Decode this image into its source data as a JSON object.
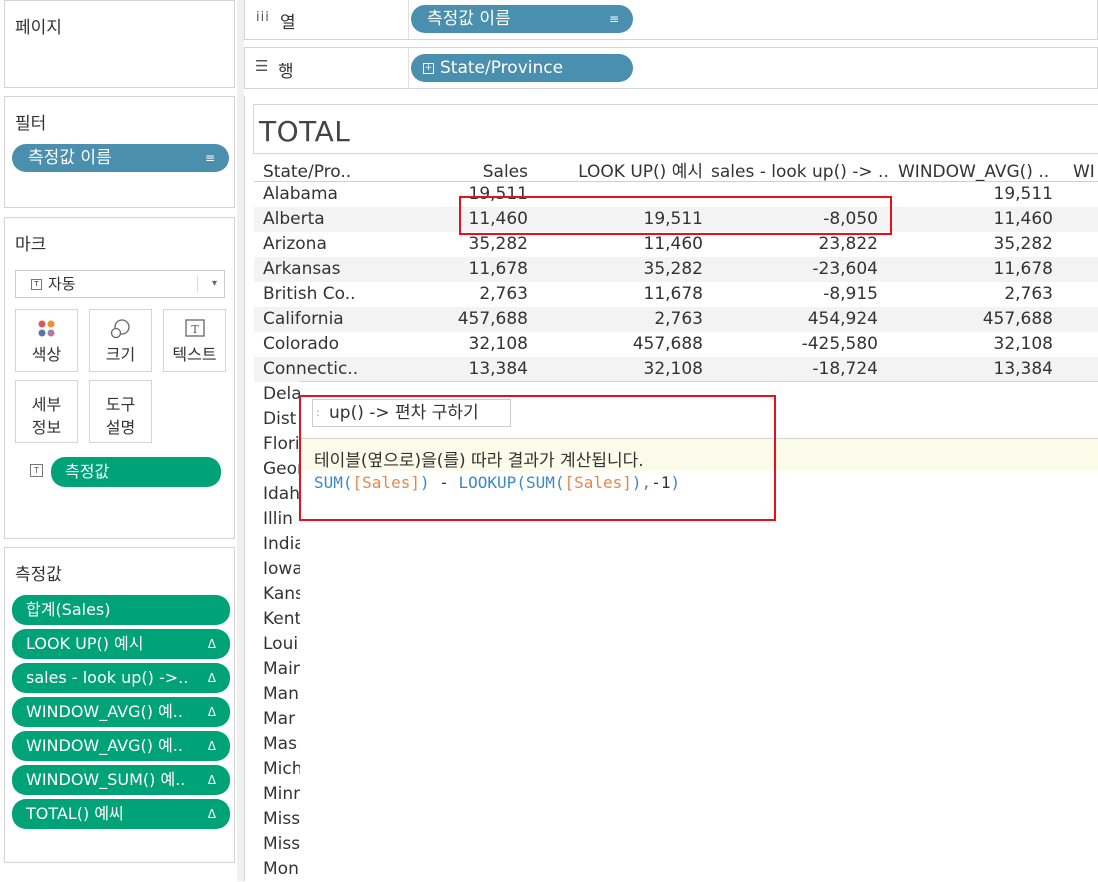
{
  "pages_panel": {
    "title": "페이지"
  },
  "filters_panel": {
    "title": "필터",
    "pill": "측정값 이름"
  },
  "marks_panel": {
    "title": "마크",
    "dropdown": "자동",
    "buttons": [
      {
        "label": "색상",
        "icon": "color-dots-icon"
      },
      {
        "label": "크기",
        "icon": "size-circles-icon"
      },
      {
        "label": "텍스트",
        "icon": "text-box-icon"
      }
    ],
    "buttons2": [
      {
        "label1": "세부",
        "label2": "정보"
      },
      {
        "label1": "도구",
        "label2": "설명"
      }
    ],
    "text_pill": "측정값"
  },
  "measures_panel": {
    "title": "측정값",
    "pills": [
      "합계(Sales)",
      "LOOK UP() 예시",
      "sales - look up() ->..",
      "WINDOW_AVG() 예..",
      "WINDOW_AVG() 예..",
      "WINDOW_SUM() 예..",
      "TOTAL() 예씨"
    ]
  },
  "shelves": {
    "columns_label": "열",
    "columns_pill": "측정값 이름",
    "rows_label": "행",
    "rows_pill": "State/Province"
  },
  "view": {
    "title": "TOTAL",
    "headers": [
      "State/Pro..",
      "Sales",
      "LOOK UP() 예시",
      "sales - look up() -> ..",
      "WINDOW_AVG() ..",
      "WI"
    ],
    "rows": [
      {
        "state": "Alabama",
        "sales": "19,511",
        "lookup": "",
        "diff": "",
        "wavg": "19,511"
      },
      {
        "state": "Alberta",
        "sales": "11,460",
        "lookup": "19,511",
        "diff": "-8,050",
        "wavg": "11,460"
      },
      {
        "state": "Arizona",
        "sales": "35,282",
        "lookup": "11,460",
        "diff": "23,822",
        "wavg": "35,282"
      },
      {
        "state": "Arkansas",
        "sales": "11,678",
        "lookup": "35,282",
        "diff": "-23,604",
        "wavg": "11,678"
      },
      {
        "state": "British Co..",
        "sales": "2,763",
        "lookup": "11,678",
        "diff": "-8,915",
        "wavg": "2,763"
      },
      {
        "state": "California",
        "sales": "457,688",
        "lookup": "2,763",
        "diff": "454,924",
        "wavg": "457,688"
      },
      {
        "state": "Colorado",
        "sales": "32,108",
        "lookup": "457,688",
        "diff": "-425,580",
        "wavg": "32,108"
      },
      {
        "state": "Connectic..",
        "sales": "13,384",
        "lookup": "32,108",
        "diff": "-18,724",
        "wavg": "13,384"
      }
    ],
    "truncated_rows": [
      "Dela",
      "Dist",
      "Flori",
      "Geor",
      "Idah",
      "Illin",
      "India",
      "Iowa",
      "Kans",
      "Kent",
      "Loui",
      "Main",
      "Man",
      "Mar",
      "Mas",
      "Mich",
      "Minr",
      "Miss",
      "Miss",
      "Mon"
    ]
  },
  "tooltip": {
    "name": "up() -> 편차 구하기",
    "description": "테이블(옆으로)을(를) 따라 결과가 계산됩니다.",
    "formula": {
      "fn1": "SUM(",
      "field1": "[Sales]",
      "close1": ")",
      "op": " - ",
      "fn2": "LOOKUP(",
      "fn3": "SUM(",
      "field2": "[Sales]",
      "close2": "),",
      "arg": "-1",
      "close3": ")"
    }
  }
}
